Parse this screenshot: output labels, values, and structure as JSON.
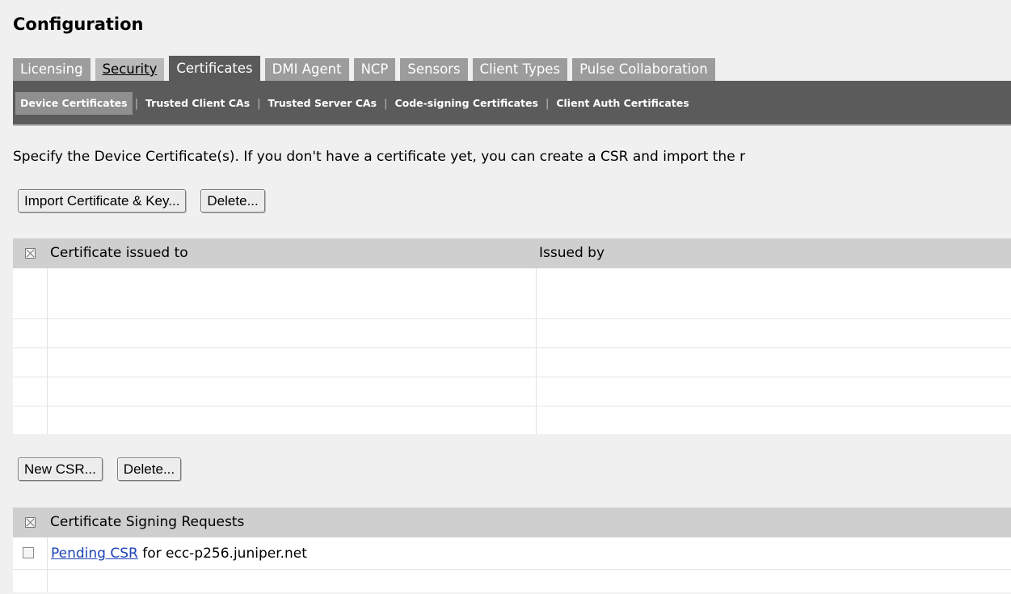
{
  "page": {
    "title": "Configuration"
  },
  "tabs": [
    {
      "label": "Licensing",
      "state": "normal"
    },
    {
      "label": "Security",
      "state": "underlined"
    },
    {
      "label": "Certificates",
      "state": "active"
    },
    {
      "label": "DMI Agent",
      "state": "normal"
    },
    {
      "label": "NCP",
      "state": "normal"
    },
    {
      "label": "Sensors",
      "state": "normal"
    },
    {
      "label": "Client Types",
      "state": "normal"
    },
    {
      "label": "Pulse Collaboration",
      "state": "normal"
    }
  ],
  "subnav": {
    "items": [
      {
        "label": "Device Certificates",
        "active": true
      },
      {
        "label": "Trusted Client CAs",
        "active": false
      },
      {
        "label": "Trusted Server CAs",
        "active": false
      },
      {
        "label": "Code-signing Certificates",
        "active": false
      },
      {
        "label": "Client Auth Certificates",
        "active": false
      }
    ]
  },
  "intro": {
    "text": "Specify the Device Certificate(s). If you don't have a certificate yet, you can create a CSR and import the r"
  },
  "device_cert_actions": {
    "import_label": "Import Certificate & Key...",
    "delete_label": "Delete..."
  },
  "device_cert_table": {
    "col_issued_to": "Certificate issued to",
    "col_issued_by": "Issued by",
    "rows": [
      [],
      [],
      [],
      [],
      []
    ]
  },
  "csr_actions": {
    "new_label": "New CSR...",
    "delete_label": "Delete..."
  },
  "csr_table": {
    "header": "Certificate Signing Requests",
    "rows": [
      {
        "link_text": "Pending CSR",
        "suffix": " for ecc-p256.juniper.net"
      }
    ]
  },
  "colors": {
    "tab_inactive_bg": "#9c9c9c",
    "tab_active_bg": "#5a5a5a",
    "subnav_bg": "#5b5b5b",
    "header_bg": "#cfcfcf",
    "link": "#1d43b8"
  }
}
